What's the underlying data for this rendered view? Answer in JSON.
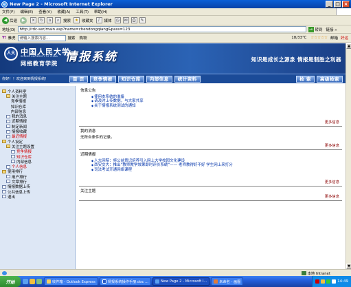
{
  "window": {
    "title": "New Page 2 - Microsoft Internet Explorer",
    "min": "_",
    "max": "□",
    "close": "×"
  },
  "menu": [
    "文件(F)",
    "编辑(E)",
    "查看(V)",
    "收藏(A)",
    "工具(T)",
    "帮助(H)"
  ],
  "toolbar": {
    "back": "后退",
    "search": "搜索",
    "favorites": "收藏夹",
    "media": "媒体"
  },
  "address": {
    "label": "地址(D)",
    "url": "http://rdc-ser/main.asp?name=chendongqiang&pass=123",
    "go": "转到",
    "links": "链接 »"
  },
  "searchbar": {
    "brand": "雅虎",
    "placeholder": "请输入搜索内容...",
    "search": "搜索",
    "shopping": "购物",
    "weather": "18/33℃",
    "rating": "☆☆☆☆☆",
    "mail": "邮箱",
    "lucky": "好运"
  },
  "banner": {
    "seal": "人大",
    "school": "中国人民大学",
    "school_en": "RENMIN UNIVERSITY OF CHINA",
    "college": "网络教育学院",
    "system": "情报系统",
    "slogan": "知识是成长之源泉   情报是制胜之利器"
  },
  "nav": {
    "welcome": "你好！！欢迎来到情报系统！",
    "items": [
      "首 页",
      "竞争情报",
      "知识仓库",
      "内部信息",
      "统计资料"
    ],
    "right": [
      "检 索",
      "高级检索"
    ]
  },
  "tree": [
    {
      "label": "个人资料室",
      "level": 1,
      "icon": "folder"
    },
    {
      "label": "关注主题",
      "level": 2,
      "icon": "folder"
    },
    {
      "label": "竞争情报",
      "level": 3,
      "icon": "none"
    },
    {
      "label": "知识仓库",
      "level": 3,
      "icon": "none"
    },
    {
      "label": "内部信息",
      "level": 3,
      "icon": "none"
    },
    {
      "label": "我的消息",
      "level": 2,
      "icon": "page"
    },
    {
      "label": "近期情报",
      "level": 2,
      "icon": "page"
    },
    {
      "label": "制定新闻",
      "level": 2,
      "icon": "page"
    },
    {
      "label": "情报收藏",
      "level": 2,
      "icon": "page"
    },
    {
      "label": "最近情报",
      "level": 2,
      "icon": "page",
      "red": true
    },
    {
      "label": "个人设定",
      "level": 1,
      "icon": "folder"
    },
    {
      "label": "关注主题设置",
      "level": 2,
      "icon": "folder"
    },
    {
      "label": "竞争情报",
      "level": 3,
      "icon": "page",
      "red": true
    },
    {
      "label": "知识仓库",
      "level": 3,
      "icon": "page",
      "red": true
    },
    {
      "label": "内部信息",
      "level": 3,
      "icon": "page"
    },
    {
      "label": "个人信息",
      "level": 2,
      "icon": "page",
      "red": true
    },
    {
      "label": "使用排行",
      "level": 1,
      "icon": "folder"
    },
    {
      "label": "用户排行",
      "level": 2,
      "icon": "page"
    },
    {
      "label": "文章排行",
      "level": 2,
      "icon": "page"
    },
    {
      "label": "情报数据上传",
      "level": 1,
      "icon": "page"
    },
    {
      "label": "公共信息上传",
      "level": 1,
      "icon": "page"
    },
    {
      "label": "退出",
      "level": 1,
      "icon": "page"
    }
  ],
  "sections": [
    {
      "title": "信息公告",
      "items": [
        "使用本系统的准备",
        "请及时上传数据，与大家共享",
        "关于情报系统测试的通知"
      ],
      "text": "",
      "more": "更多信息"
    },
    {
      "title": "我的消息",
      "items": [],
      "text": "无所合条件的记录。",
      "more": "更多信息"
    },
    {
      "title": "近期情报",
      "items": [
        "人大网院：将公益意识培养引入网上大学校园文化建设",
        "西安交大：推出“教师教学效果即时评价系统”—— 老师教得好不好 学生网上来打分",
        "司法考试开通网络课程"
      ],
      "text": "",
      "more": "更多信息"
    },
    {
      "title": "关注主题",
      "items": [],
      "text": "",
      "more": "更多信息"
    }
  ],
  "status": {
    "zone": "本地 Intranet"
  },
  "taskbar": {
    "start": "开始",
    "tasks": [
      "收件箱 - Outlook Express",
      "情报系统操作手册.doc ...",
      "New Page 2 - Microsoft I...",
      "未命名 - 画图"
    ],
    "active_index": 2,
    "time": "14:49"
  }
}
